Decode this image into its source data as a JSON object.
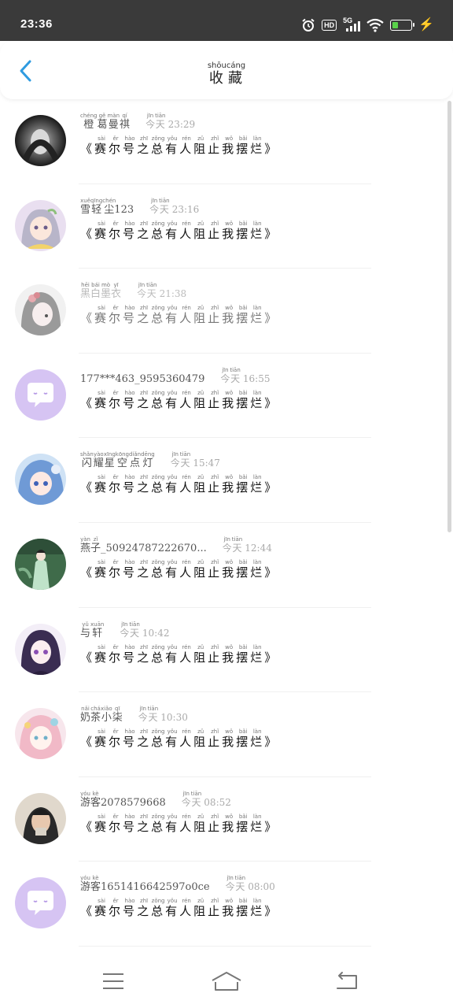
{
  "status_bar": {
    "time": "23:36",
    "hd_label": "HD",
    "network_label": "5G",
    "battery_level": 0.3,
    "icons": [
      "alarm-icon",
      "hd-icon",
      "signal-5g-icon",
      "wifi-icon",
      "battery-icon",
      "charging-bolt-icon"
    ]
  },
  "header": {
    "title": "收藏",
    "title_chars": [
      {
        "char": "收",
        "pinyin": "shōu"
      },
      {
        "char": "藏",
        "pinyin": "cáng"
      }
    ],
    "back_icon": "chevron-left-icon"
  },
  "accent_color": "#2f9be0",
  "message": {
    "open_bracket": "《",
    "close_bracket": "》",
    "chars": [
      {
        "char": "赛",
        "pinyin": "sài"
      },
      {
        "char": "尔",
        "pinyin": "ěr"
      },
      {
        "char": "号",
        "pinyin": "hào"
      },
      {
        "char": "之",
        "pinyin": "zhī"
      },
      {
        "char": "总",
        "pinyin": "zǒng"
      },
      {
        "char": "有",
        "pinyin": "yǒu"
      },
      {
        "char": "人",
        "pinyin": "rén"
      },
      {
        "char": "阻",
        "pinyin": "zǔ"
      },
      {
        "char": "止",
        "pinyin": "zhǐ"
      },
      {
        "char": "我",
        "pinyin": "wǒ"
      },
      {
        "char": "摆",
        "pinyin": "bǎi"
      },
      {
        "char": "烂",
        "pinyin": "làn"
      }
    ]
  },
  "items": [
    {
      "name": "橙葛曼祺",
      "name_pinyin": [
        "chéng",
        "gě",
        "màn",
        "qí"
      ],
      "time_prefix": "今天",
      "time_prefix_pinyin": [
        "jīn",
        "tiān"
      ],
      "time": "23:29",
      "avatar": "dark-hood-portrait",
      "dim": false
    },
    {
      "name": "雪轻尘123",
      "name_pinyin": [
        "xuě",
        "qīng",
        "chén"
      ],
      "time_prefix": "今天",
      "time_prefix_pinyin": [
        "jīn",
        "tiān"
      ],
      "time": "23:16",
      "avatar": "anime-silver-hair",
      "dim": false
    },
    {
      "name": "黑白墨衣",
      "name_pinyin": [
        "hēi",
        "bái",
        "mò",
        "yī"
      ],
      "time_prefix": "今天",
      "time_prefix_pinyin": [
        "jīn",
        "tiān"
      ],
      "time": "21:38",
      "avatar": "anime-grey-flowers",
      "dim": true
    },
    {
      "name": "177***463_9595360479",
      "name_pinyin": [],
      "time_prefix": "今天",
      "time_prefix_pinyin": [
        "jīn",
        "tiān"
      ],
      "time": "16:55",
      "avatar": "default-chat-bubble",
      "dim": false
    },
    {
      "name": "闪耀星空点灯",
      "name_pinyin": [
        "shǎn",
        "yào",
        "xīng",
        "kōng",
        "diǎn",
        "dēng"
      ],
      "time_prefix": "今天",
      "time_prefix_pinyin": [
        "jīn",
        "tiān"
      ],
      "time": "15:47",
      "avatar": "anime-blue-hair",
      "dim": false
    },
    {
      "name": "燕子_50924787222670...",
      "name_pinyin": [
        "yàn",
        "zǐ"
      ],
      "time_prefix": "今天",
      "time_prefix_pinyin": [
        "jīn",
        "tiān"
      ],
      "time": "12:44",
      "avatar": "green-robe-figure",
      "dim": false
    },
    {
      "name": "与轩",
      "name_pinyin": [
        "yǔ",
        "xuān"
      ],
      "time_prefix": "今天",
      "time_prefix_pinyin": [
        "jīn",
        "tiān"
      ],
      "time": "10:42",
      "avatar": "anime-purple-hair",
      "dim": false
    },
    {
      "name": "奶茶小柒",
      "name_pinyin": [
        "nǎi",
        "chá",
        "xiǎo",
        "qī"
      ],
      "time_prefix": "今天",
      "time_prefix_pinyin": [
        "jīn",
        "tiān"
      ],
      "time": "10:30",
      "avatar": "anime-pastel-girl",
      "dim": false
    },
    {
      "name": "游客2078579668",
      "name_pinyin": [
        "yóu",
        "kè"
      ],
      "time_prefix": "今天",
      "time_prefix_pinyin": [
        "jīn",
        "tiān"
      ],
      "time": "08:52",
      "avatar": "photo-person",
      "dim": false
    },
    {
      "name": "游客1651416642597o0ce",
      "name_pinyin": [
        "yóu",
        "kè"
      ],
      "time_prefix": "今天",
      "time_prefix_pinyin": [
        "jīn",
        "tiān"
      ],
      "time": "08:00",
      "avatar": "default-chat-bubble",
      "dim": false
    }
  ],
  "nav_bar": {
    "icons": [
      "menu-icon",
      "home-icon",
      "back-arrow-icon"
    ]
  }
}
